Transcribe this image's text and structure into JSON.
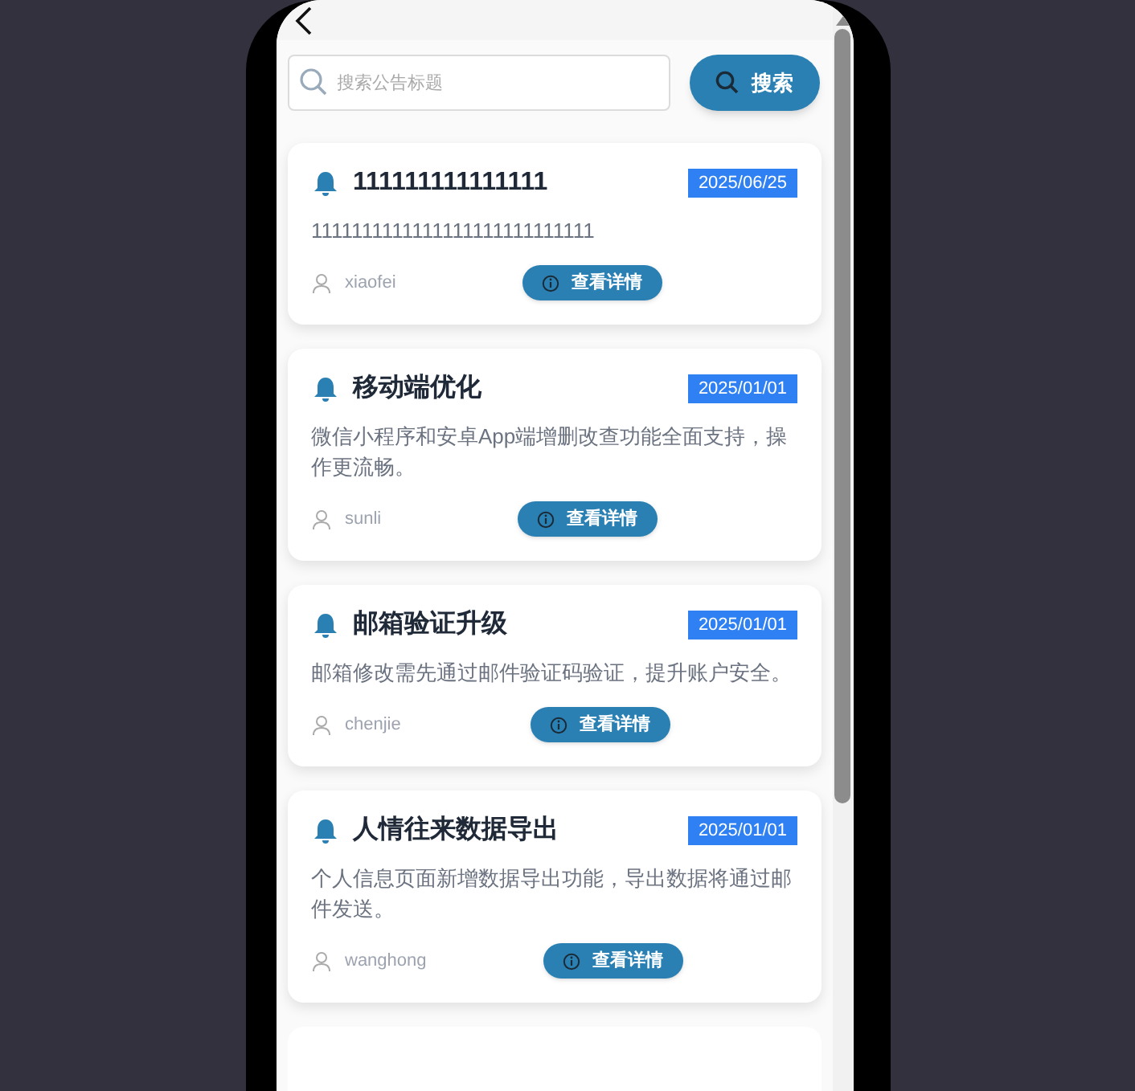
{
  "search": {
    "placeholder": "搜索公告标题",
    "button": "搜索"
  },
  "notices": [
    {
      "title": "111111111111111",
      "date": "2025/06/25",
      "body": "1111111111111111111111111111",
      "author": "xiaofei",
      "action": "查看详情"
    },
    {
      "title": "移动端优化",
      "date": "2025/01/01",
      "body": "微信小程序和安卓App端增删改查功能全面支持，操作更流畅。",
      "author": "sunli",
      "action": "查看详情"
    },
    {
      "title": "邮箱验证升级",
      "date": "2025/01/01",
      "body": "邮箱修改需先通过邮件验证码验证，提升账户安全。",
      "author": "chenjie",
      "action": "查看详情"
    },
    {
      "title": "人情往来数据导出",
      "date": "2025/01/01",
      "body": "个人信息页面新增数据导出功能，导出数据将通过邮件发送。",
      "author": "wanghong",
      "action": "查看详情"
    }
  ]
}
